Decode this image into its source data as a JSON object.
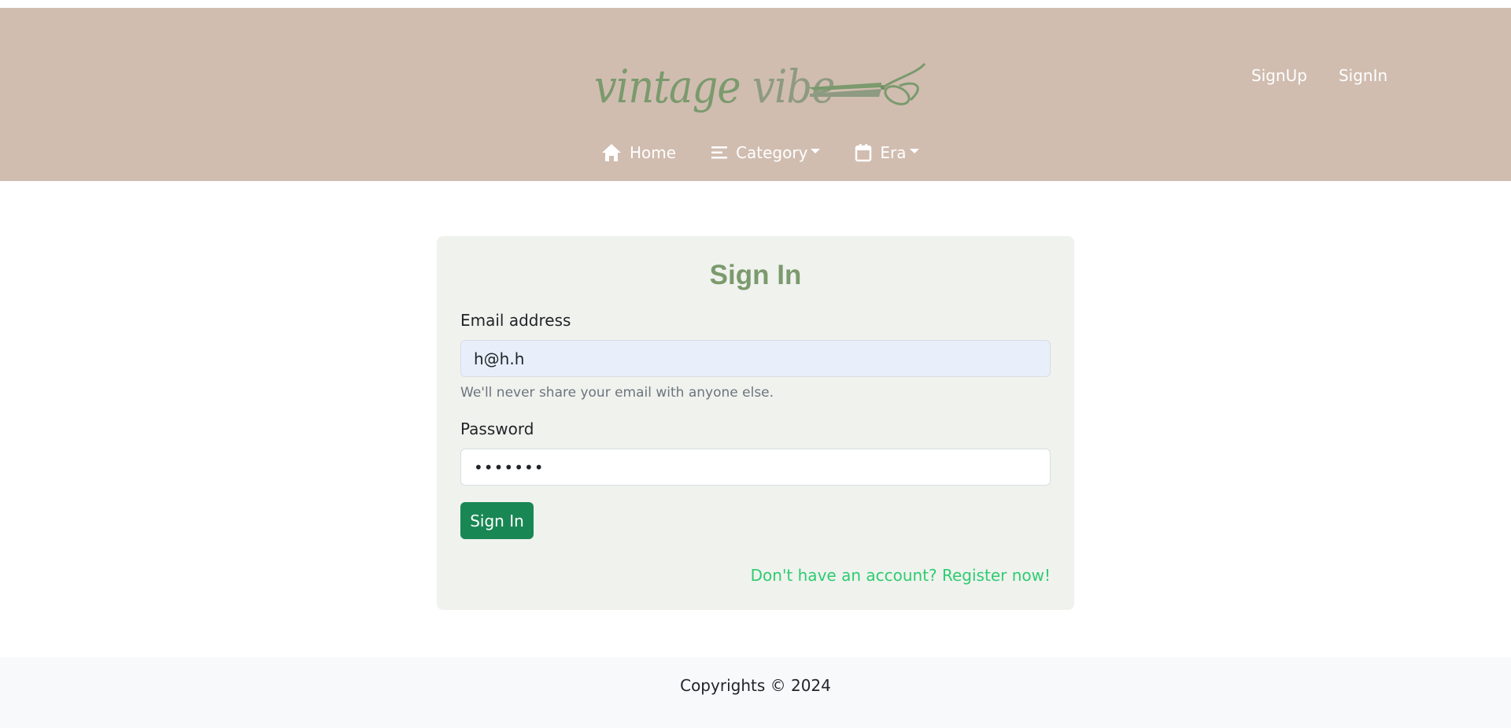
{
  "brand": {
    "logo_word1": "vintage",
    "logo_word2": "vibe",
    "logo_icon": "scissors-icon"
  },
  "auth": {
    "signup": "SignUp",
    "signin": "SignIn"
  },
  "nav": {
    "home": {
      "label": "Home",
      "icon": "home-icon"
    },
    "category": {
      "label": "Category",
      "icon": "list-icon"
    },
    "era": {
      "label": "Era",
      "icon": "calendar-icon"
    }
  },
  "form": {
    "title": "Sign In",
    "email_label": "Email address",
    "email_value": "h@h.h",
    "email_help": "We'll never share your email with anyone else.",
    "password_label": "Password",
    "password_value": "•••••••",
    "submit_label": "Sign In",
    "register_link": "Don't have an account? Register now!"
  },
  "footer": {
    "copyright": "Copyrights © 2024"
  },
  "colors": {
    "header_bg": "#d0bdb0",
    "brand_green": "#7b9a6d",
    "button_green": "#198754",
    "link_green": "#2ecc71",
    "card_bg": "#f0f2ee"
  }
}
